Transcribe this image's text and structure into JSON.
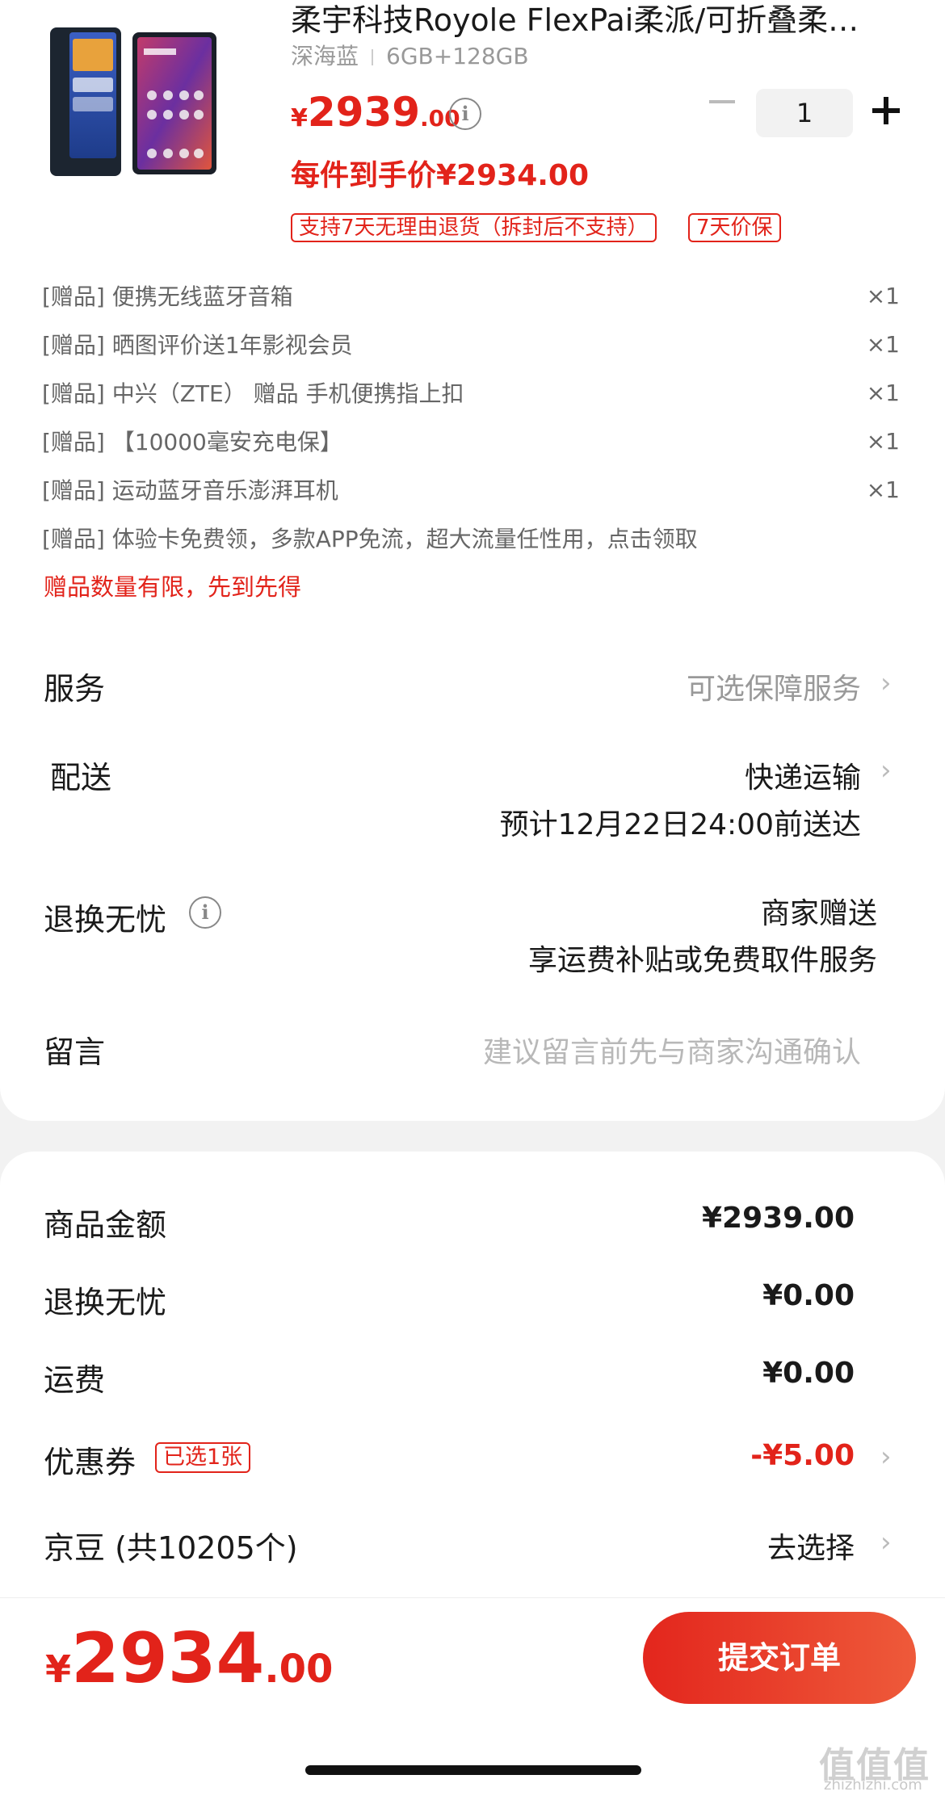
{
  "product": {
    "title": "柔宇科技Royole FlexPai柔派/可折叠柔…",
    "color": "深海蓝",
    "spec": "6GB+128GB",
    "price_currency": "¥",
    "price_int": "2939",
    "price_dec": ".00",
    "quantity": "1",
    "final_price": "每件到手价¥2934.00",
    "tags": [
      "支持7天无理由退货（拆封后不支持）",
      "7天价保"
    ]
  },
  "gifts": [
    {
      "label": "[赠品] 便携无线蓝牙音箱",
      "qty": "×1"
    },
    {
      "label": "[赠品] 晒图评价送1年影视会员",
      "qty": "×1"
    },
    {
      "label": "[赠品] 中兴（ZTE） 赠品 手机便携指上扣",
      "qty": "×1"
    },
    {
      "label": "[赠品] 【10000毫安充电保】",
      "qty": "×1"
    },
    {
      "label": "[赠品] 运动蓝牙音乐澎湃耳机",
      "qty": "×1"
    },
    {
      "label": "[赠品] 体验卡免费领，多款APP免流，超大流量任性用，点击领取",
      "qty": ""
    }
  ],
  "gift_note": "赠品数量有限，先到先得",
  "service": {
    "label": "服务",
    "value": "可选保障服务"
  },
  "delivery": {
    "label": "配送",
    "method": "快递运输",
    "eta": "预计12月22日24:00前送达"
  },
  "worry_free": {
    "label": "退换无忧",
    "line1": "商家赠送",
    "line2": "享运费补贴或免费取件服务"
  },
  "message": {
    "label": "留言",
    "placeholder": "建议留言前先与商家沟通确认"
  },
  "summary": {
    "goods_label": "商品金额",
    "goods_value": "¥2939.00",
    "worry_label": "退换无忧",
    "worry_value": "¥0.00",
    "freight_label": "运费",
    "freight_value": "¥0.00",
    "coupon_label": "优惠券",
    "coupon_badge": "已选1张",
    "coupon_value": "-¥5.00",
    "beans_label": "京豆 (共10205个)",
    "beans_value": "去选择"
  },
  "footer": {
    "total_currency": "¥",
    "total_int": "2934",
    "total_dec": ".00",
    "submit_label": "提交订单"
  },
  "watermark": {
    "text": "值值值",
    "url_text": "zhizhizhi.com"
  },
  "colors": {
    "accent": "#e2231a",
    "background": "#f2f2f2"
  }
}
